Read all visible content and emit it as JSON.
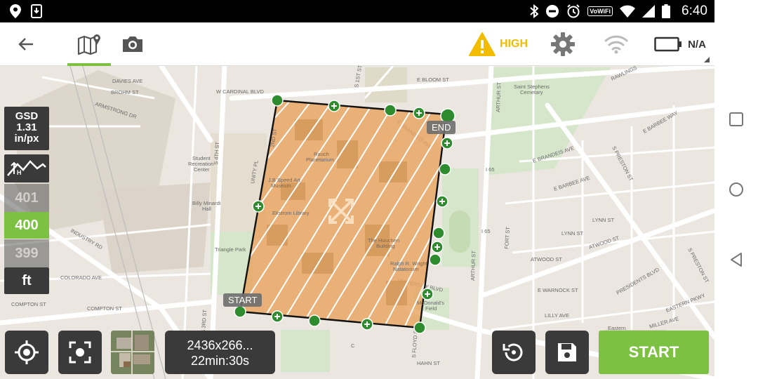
{
  "status_bar": {
    "time": "6:40",
    "wifi_tag": "VoWiFi",
    "icons": [
      "location-icon",
      "download-icon",
      "bluetooth-icon",
      "dnd-icon",
      "alarm-icon",
      "wifi-icon",
      "signal-icon",
      "battery-icon"
    ]
  },
  "toolbar": {
    "risk_label": "HIGH",
    "battery_label": "N/A",
    "icons": [
      "back-arrow-icon",
      "map-icon",
      "camera-icon",
      "warning-icon",
      "gear-icon",
      "wifi-icon",
      "battery-icon"
    ],
    "risk_color": "#f2bd00",
    "accent_color": "#7cc142"
  },
  "altitude_panel": {
    "gsd_label": "GSD",
    "gsd_value": "1.31",
    "gsd_unit": "in/px",
    "altitude_above": "401",
    "altitude_selected": "400",
    "altitude_below": "399",
    "unit": "ft"
  },
  "map": {
    "start_flag": "START",
    "end_flag": "END",
    "labels": {
      "davies": "DAVIES AVE",
      "brohm": "BROHM ST",
      "armstrong": "ARMSTRONG DR",
      "cardinal": "W CARDINAL BLVD",
      "ebloom": "E BLOOM ST",
      "saint_stephens": "Saint Stephens",
      "cemetary": "Cemetary",
      "rawlings": "RAWLINGS",
      "ebrandeis": "E BRANDEIS AVE",
      "ebarbee_way": "E BARBEE WAY",
      "ebarbee": "E BARBEE AVE",
      "student_rec_1": "Student",
      "student_rec_2": "Recreation",
      "student_rec_3": "Center",
      "billy_1": "Billy Minardi",
      "billy_2": "Hall",
      "industry": "INDUSTRY RD",
      "triangle": "Triangle Park",
      "colorado": "COLORADO AVE",
      "compton": "COMPTON ST",
      "atwood": "ATWOOD ST",
      "lynn": "LYNN ST",
      "warnock": "E WARNOCK ST",
      "lilly": "LILLY AVE",
      "presidents": "PRESIDENTS BLVD",
      "eastern": "EASTERN PKWY",
      "miller": "MILLER AVE",
      "university": "UNIVERSITY BLVD",
      "hahn": "HAHN ST",
      "i65": "I 65",
      "eastern_area": "Eastern",
      "rauch_1": "Rauch",
      "rauch_2": "Planetarium",
      "speed_1": "J.B Speed Art",
      "speed_2": "Museum",
      "ekstrom": "Ekstrom Library",
      "houchen_1": "The Houchen",
      "houchen_2": "Building",
      "wright_1": "Ralph R. Wright",
      "wright_2": "Natatorium",
      "mcdonald_1": "McDonald's",
      "mcdonald_2": "Field",
      "arthur": "ARTHUR ST",
      "preston": "S PRESTON ST",
      "floyd": "S FLOYD ST",
      "third": "S 3RD ST",
      "fourth": "S 4TH ST",
      "fortst": "FORT ST",
      "unity": "UNITY PL",
      "second": "2ND ST",
      "first": "S 1ST ST",
      "c_label": "C"
    }
  },
  "bottom_bar": {
    "grid_size": "2436x266...",
    "duration": "22min:30s",
    "start_label": "START",
    "icons": [
      "locate-icon",
      "focus-icon",
      "satellite-thumbnail",
      "rotate-icon",
      "save-icon"
    ]
  }
}
